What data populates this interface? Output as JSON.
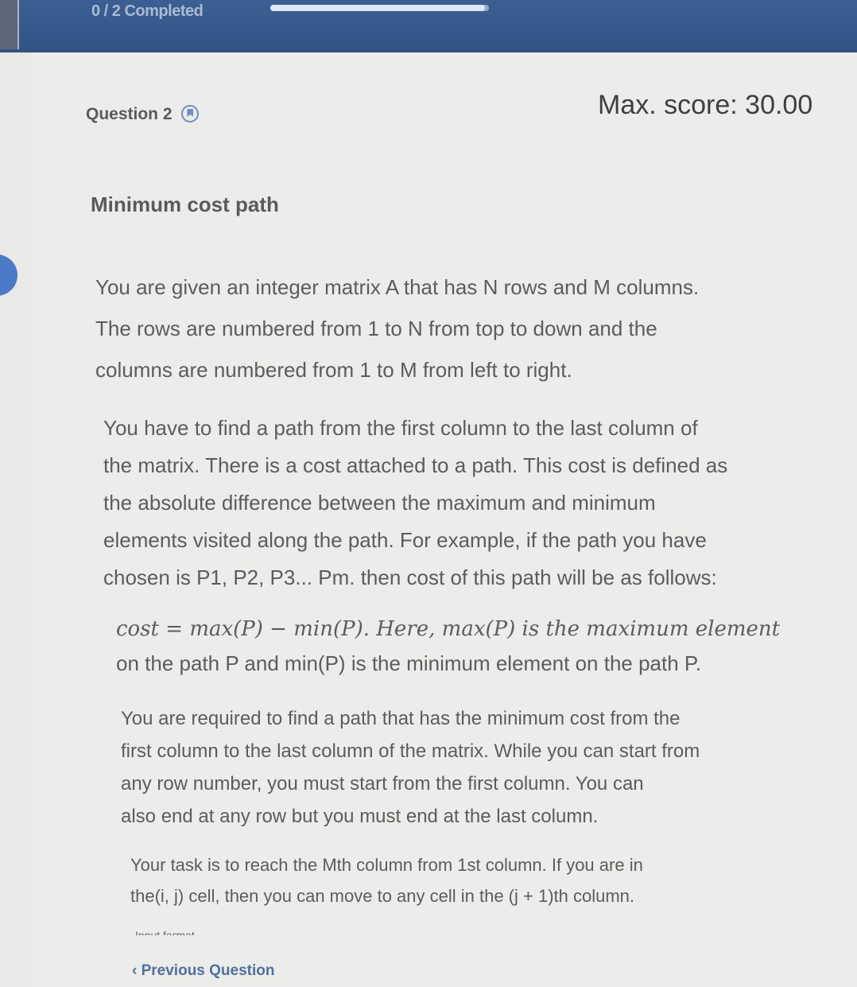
{
  "header": {
    "progress_label": "0 / 2 Completed",
    "progress_fraction": 0
  },
  "question": {
    "label": "Question 2",
    "bookmark_icon": "bookmark-icon",
    "max_score": "Max. score: 30.00"
  },
  "problem": {
    "title": "Minimum cost path",
    "p1": [
      "You are given an integer matrix A that has N rows and M columns.",
      "The rows are numbered from 1 to N from top to down and the",
      "columns are numbered from 1 to M from left to right."
    ],
    "p2": [
      "You have to find a path from the first column to the last column of",
      "the matrix. There is a cost attached to a path. This cost is defined as",
      "the absolute difference between the maximum and minimum",
      "elements visited along the path. For example, if the path you have",
      "chosen is P1, P2, P3... Pm. then cost of this path will be as follows:"
    ],
    "p3": [
      "cost = max(P) − min(P). Here, max(P) is the maximum element",
      "on the path P and min(P) is the minimum element on the path P."
    ],
    "p4": [
      "You are required to find a path that has the minimum cost from the",
      "first column to the last column of the matrix. While you can start from",
      "any row number, you must start from the first column. You can",
      "also end at any row but you must end at the last column."
    ],
    "p5": [
      "Your task is to reach the Mth column from 1st column. If you are in",
      "the(i, j) cell, then you can move to any cell in the (j + 1)th column."
    ],
    "cut_off_heading": "Input format"
  },
  "footer": {
    "previous_label": "‹ Previous Question"
  }
}
